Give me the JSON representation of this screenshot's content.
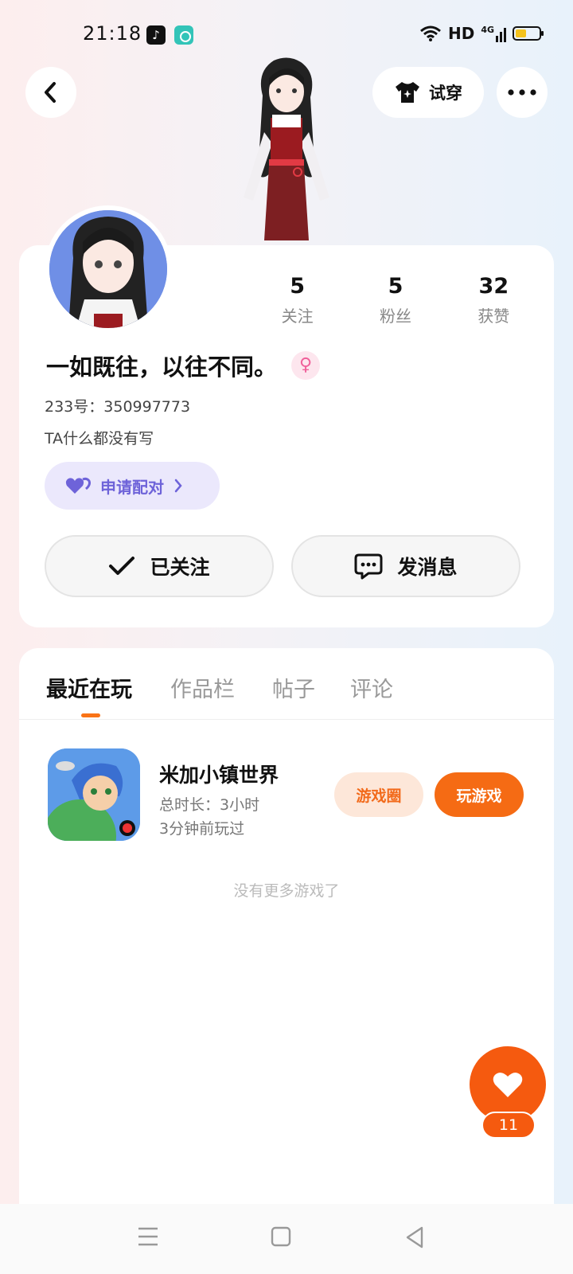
{
  "status_bar": {
    "time": "21:18",
    "network": "HD",
    "signal": "4G",
    "battery_level": 0.45,
    "battery_color": "#f4c21c"
  },
  "header": {
    "back_icon": "chevron-left-icon",
    "tryon_label": "试穿",
    "tryon_icon": "tshirt-icon",
    "more_icon": "more-icon"
  },
  "profile": {
    "stats": [
      {
        "value": "5",
        "label": "关注"
      },
      {
        "value": "5",
        "label": "粉丝"
      },
      {
        "value": "32",
        "label": "获赞"
      }
    ],
    "nickname": "一如既往，以往不同。",
    "gender_icon": "female-icon",
    "user_id": "233号：350997773",
    "bio": "TA什么都没有写",
    "pair_label": "申请配对",
    "follow_label": "已关注",
    "message_label": "发消息"
  },
  "tabs": [
    {
      "label": "最近在玩",
      "active": true
    },
    {
      "label": "作品栏",
      "active": false
    },
    {
      "label": "帖子",
      "active": false
    },
    {
      "label": "评论",
      "active": false
    }
  ],
  "games": [
    {
      "title": "米加小镇世界",
      "duration": "总时长：3小时",
      "last_played": "3分钟前玩过",
      "circle_label": "游戏圈",
      "play_label": "玩游戏"
    }
  ],
  "empty_text": "没有更多游戏了",
  "like": {
    "count": "11"
  },
  "colors": {
    "accent": "#f56b14",
    "pair": "#6e63d9"
  }
}
